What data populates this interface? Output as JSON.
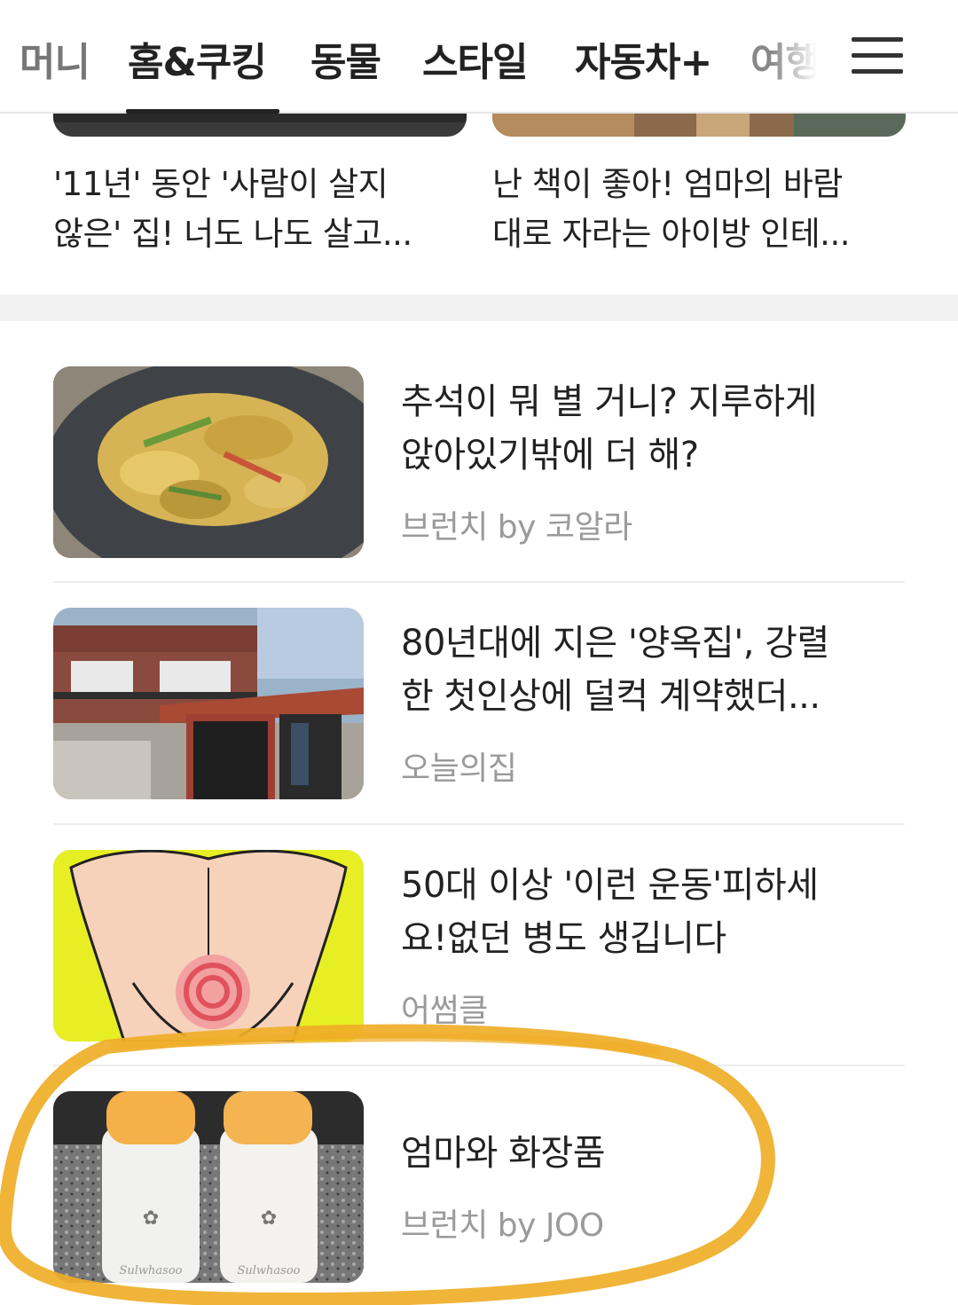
{
  "tabs": {
    "items": [
      {
        "label": "머니"
      },
      {
        "label": "홈&쿠킹"
      },
      {
        "label": "동물"
      },
      {
        "label": "스타일"
      },
      {
        "label": "자동차+"
      },
      {
        "label": "여행"
      }
    ],
    "active_index": 1
  },
  "top_cards": [
    {
      "title_line1": "'11년' 동안 '사람이 살지",
      "title_line2": "않은' 집! 너도 나도 살고..."
    },
    {
      "title_line1": "난 책이 좋아! 엄마의 바람",
      "title_line2": "대로 자라는 아이방 인테..."
    }
  ],
  "articles": [
    {
      "title_line1": "추석이 뭐 별 거니? 지루하게",
      "title_line2": "앉아있기밖에 더 해?",
      "source": "브런치 by 코알라"
    },
    {
      "title_line1": "80년대에 지은 '양옥집', 강렬",
      "title_line2": "한 첫인상에 덜컥 계약했더...",
      "source": "오늘의집"
    },
    {
      "title_line1": "50대 이상 '이런 운동'피하세",
      "title_line2": "요!없던 병도 생깁니다",
      "source": "어썸클"
    },
    {
      "title_line1": "엄마와 화장품",
      "source": "브런치 by JOO",
      "thumb_text": "Sulwhasoo"
    }
  ],
  "colors": {
    "highlight_circle": "#EFAE28",
    "source_text": "#9A9A9A",
    "active_underline": "#222222"
  }
}
